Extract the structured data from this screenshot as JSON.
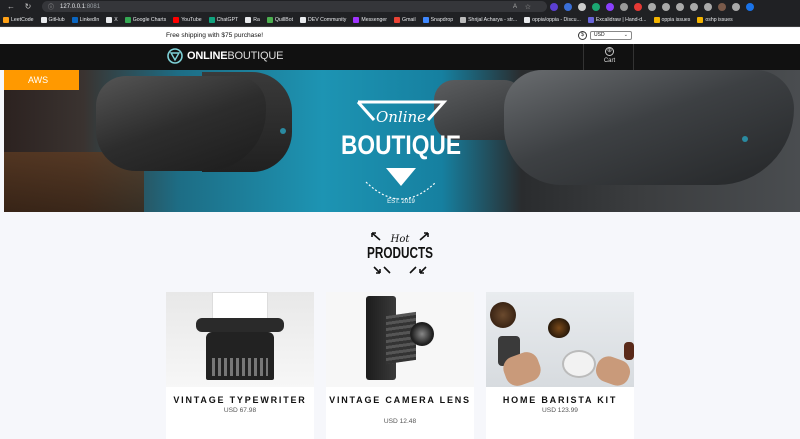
{
  "browser": {
    "url_host": "127.0.0.1",
    "url_port": ":8081",
    "nav_icons": [
      "back-arrow-icon",
      "refresh-icon"
    ]
  },
  "bookmarks": [
    {
      "label": "LeetCode",
      "color": "#ffa116"
    },
    {
      "label": "GitHub",
      "color": "#e8eaed"
    },
    {
      "label": "LinkedIn",
      "color": "#0a66c2"
    },
    {
      "label": "X",
      "color": "#e8eaed"
    },
    {
      "label": "Google Charts",
      "color": "#34a853"
    },
    {
      "label": "YouTube",
      "color": "#ff0000"
    },
    {
      "label": "ChatGPT",
      "color": "#10a37f"
    },
    {
      "label": "Ra",
      "color": "#e8eaed"
    },
    {
      "label": "QuillBot",
      "color": "#4caf50"
    },
    {
      "label": "DEV Community",
      "color": "#e8eaed"
    },
    {
      "label": "Messenger",
      "color": "#a033ff"
    },
    {
      "label": "Gmail",
      "color": "#ea4335"
    },
    {
      "label": "Snapdrop",
      "color": "#3f88ff"
    },
    {
      "label": "Shrijal Acharya - str...",
      "color": "#bbbbbb"
    },
    {
      "label": "oppia/oppia - Discu...",
      "color": "#e8eaed"
    },
    {
      "label": "Excalidraw | Hand-d...",
      "color": "#6965db"
    },
    {
      "label": "oppia issues",
      "color": "#f4b400"
    },
    {
      "label": "oshp issues",
      "color": "#f4b400"
    }
  ],
  "shipping": {
    "text": "Free shipping with $75 purchase!"
  },
  "currency": {
    "icon": "dollar-circle-icon",
    "selected": "USD"
  },
  "header": {
    "logo_bold": "ONLINE",
    "logo_light": "BOUTIQUE",
    "cart_label": "Cart",
    "cart_icon": "cart-circle-icon"
  },
  "hero": {
    "tag": "AWS",
    "badge_script": "Online",
    "badge_title": "BOUTIQUE",
    "badge_est": "EST. 2019"
  },
  "section": {
    "hot": "Hot",
    "products": "PRODUCTS"
  },
  "products": [
    {
      "name": "VINTAGE TYPEWRITER",
      "price": "USD 67.98"
    },
    {
      "name": "VINTAGE CAMERA LENS",
      "price": "USD 12.48"
    },
    {
      "name": "HOME BARISTA KIT",
      "price": "USD 123.99"
    }
  ]
}
